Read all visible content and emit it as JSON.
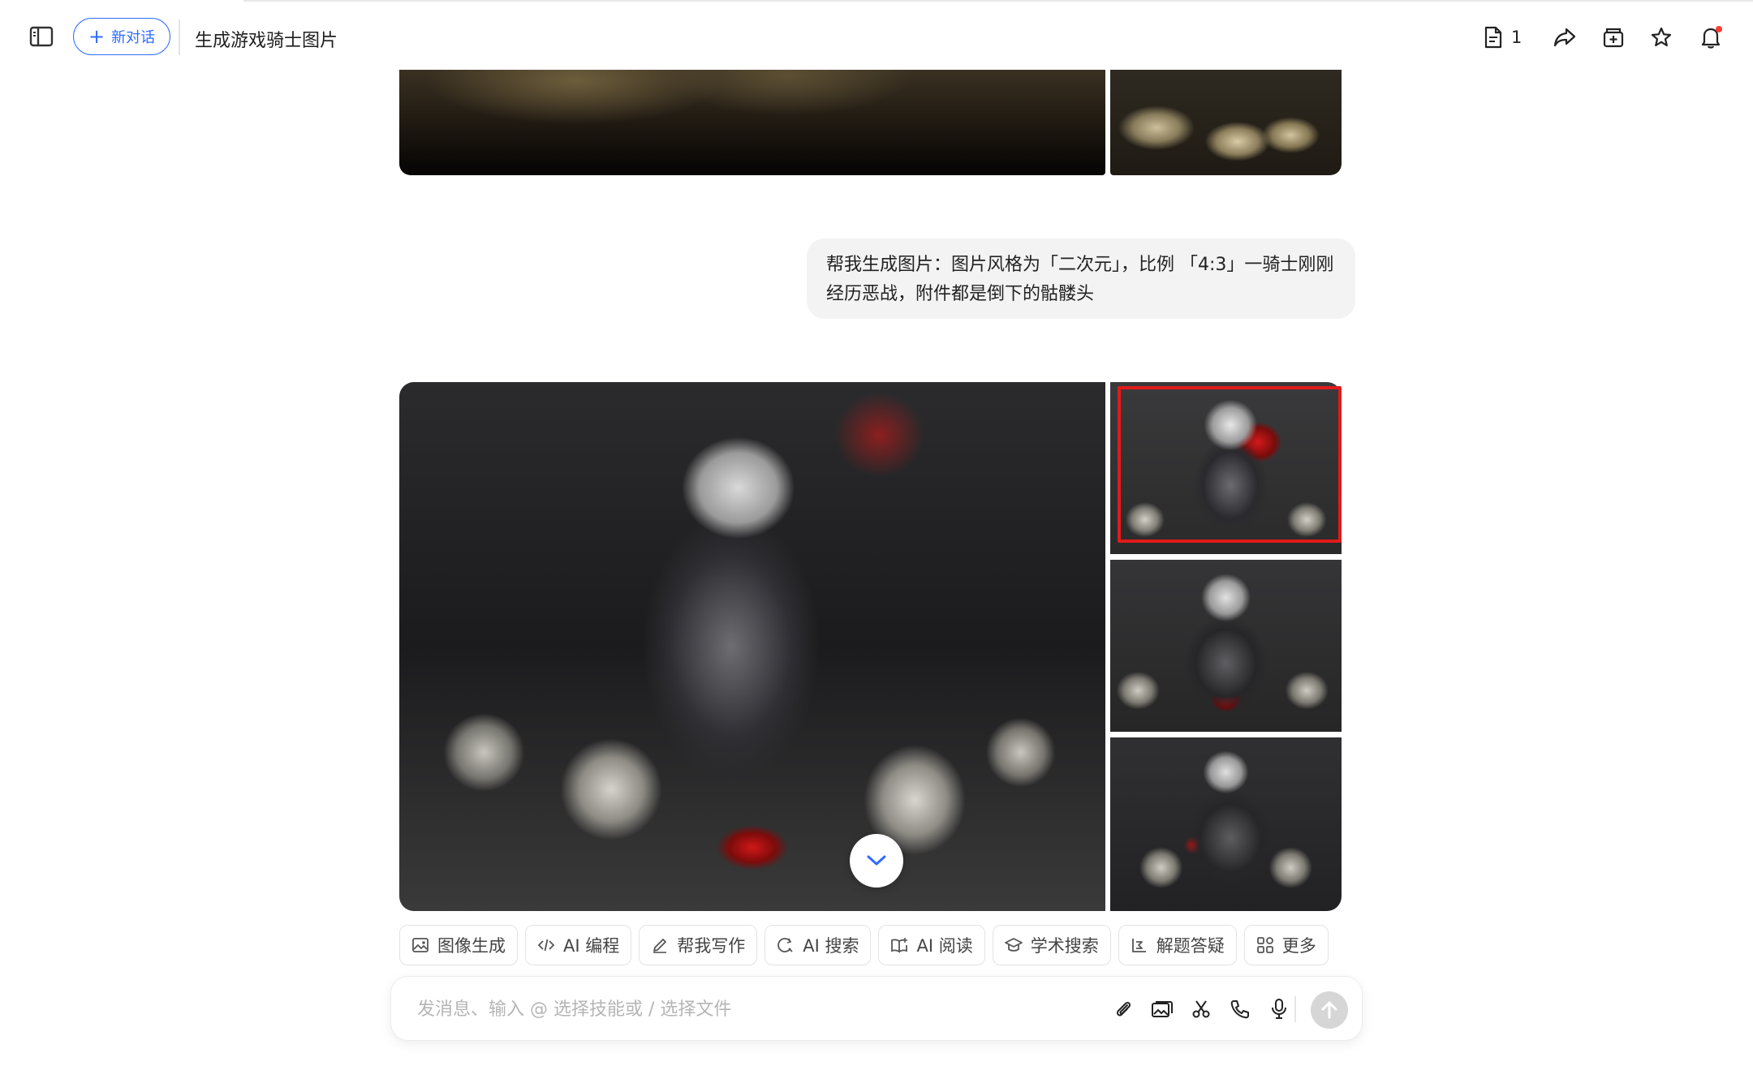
{
  "header": {
    "sidebar_toggle_icon": "sidebar-icon",
    "new_chat_label": "新对话",
    "title": "生成游戏骑士图片",
    "doc_count": "1",
    "accent_color": "#2f6bff",
    "notification_dot_color": "#ff3b30"
  },
  "messages": {
    "user_prompt": "帮我生成图片：图片风格为「二次元」，比例 「4:3」一骑士刚刚经历恶战，附件都是倒下的骷髅头"
  },
  "images": {
    "selected_thumbnail": 1,
    "selected_border_color": "#e11b1b"
  },
  "skills": [
    {
      "label": "图像生成",
      "icon": "image-gen-icon"
    },
    {
      "label": "AI 编程",
      "icon": "code-icon"
    },
    {
      "label": "帮我写作",
      "icon": "pen-icon"
    },
    {
      "label": "AI 搜索",
      "icon": "search-icon"
    },
    {
      "label": "AI 阅读",
      "icon": "book-icon"
    },
    {
      "label": "学术搜索",
      "icon": "graduation-cap-icon"
    },
    {
      "label": "解题答疑",
      "icon": "formula-icon"
    },
    {
      "label": "更多",
      "icon": "grid-icon"
    }
  ],
  "composer": {
    "placeholder": "发消息、输入 @ 选择技能或 / 选择文件",
    "value": ""
  }
}
